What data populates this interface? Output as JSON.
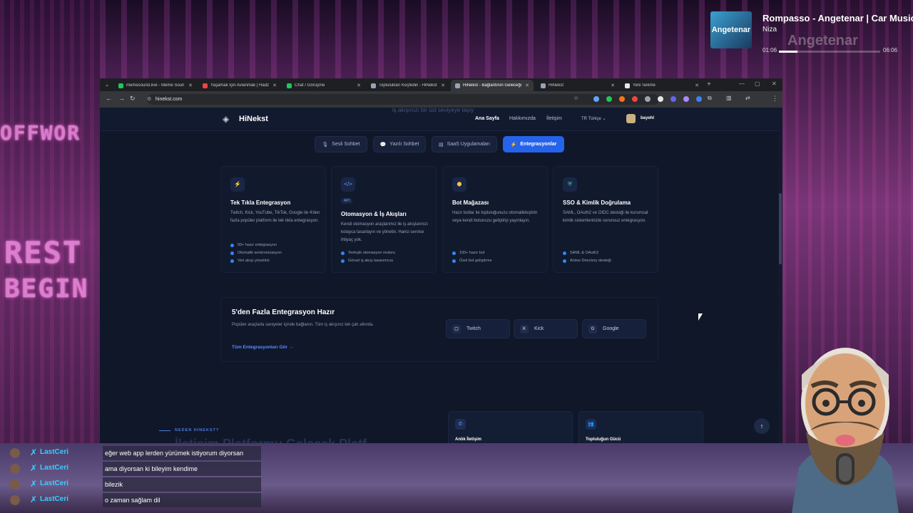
{
  "music": {
    "title": "Rompasso - Angetenar | Car Music",
    "artist": "Niza",
    "cover_text": "Angetenar",
    "ghost_text": "Angetenar",
    "elapsed": "01:06",
    "total": "06:06",
    "progress": 0.18
  },
  "browser": {
    "tabs": [
      {
        "label": "memesound.live - Meme Soun",
        "favicon_color": "#22c55e"
      },
      {
        "label": "Yaşamak İçin Avlanmak | Hadz",
        "favicon_color": "#ef4444"
      },
      {
        "label": "Chat / Görüşme",
        "favicon_color": "#22c55e"
      },
      {
        "label": "Toplulukları Keşfedin - HiNekst",
        "favicon_color": "#94a3b8"
      },
      {
        "label": "HiNekst - Bağlantının Geleceği",
        "favicon_color": "#94a3b8"
      },
      {
        "label": "HiNekst",
        "favicon_color": "#94a3b8"
      },
      {
        "label": "Yeni Sekme",
        "favicon_color": "#e5e7eb"
      }
    ],
    "url": "hinekst.com"
  },
  "site": {
    "logo": "HiNekst",
    "ghost_text": "iş akışınızı bir üst seviyeye taşıy",
    "nav": {
      "home": "Ana Sayfa",
      "about": "Hakkımızda",
      "contact": "İletişim",
      "lang": "TR  Türkçe  ⌄",
      "user": "bayehl"
    },
    "pills": [
      {
        "label": "Sesli Sohbet",
        "icon": "🎙"
      },
      {
        "label": "Yazılı Sohbet",
        "icon": "💬"
      },
      {
        "label": "SaaS Uygulamaları",
        "icon": "▤"
      },
      {
        "label": "Entegrasyonlar",
        "icon": "⚡"
      }
    ],
    "cards": [
      {
        "title": "Tek Tıkla Entegrasyon",
        "icon": "⚡",
        "desc": "Twitch, Kick, YouTube, TikTok, Google ile 4'den fazla popüler platform ile tek tıkla entegrasyon.",
        "features": [
          "50+ hazır entegrasyon",
          "Otomatik senkronizasyon",
          "Veri akışı yönetimi"
        ]
      },
      {
        "title": "Otomasyon & İş Akışları",
        "icon": "</>",
        "badge": "API",
        "desc": "Kendi otomasyon araçlarımız ile iş akışlarınızı kolayca tasarlayın ve yönetin. Harici servise ihtiyaç yok.",
        "features": [
          "Yerleşik otomasyon motoru",
          "Görsel iş akışı tasarımcısı"
        ]
      },
      {
        "title": "Bot Mağazası",
        "icon": "⬢",
        "desc": "Hazır botlar ile topluluğunuzu otomatikleştirin veya kendi botunuzu geliştirip yayınlayın.",
        "features": [
          "100+ hazır bot",
          "Özel bot geliştirme"
        ]
      },
      {
        "title": "SSO & Kimlik Doğrulama",
        "icon": "⛨",
        "desc": "SAML, OAuth2 ve OIDC desteği ile kurumsal kimlik sistemlerinizle sorunsuz entegrasyon.",
        "features": [
          "SAML & OAuth2",
          "Active Directory desteği"
        ]
      }
    ],
    "integrations": {
      "title": "5'den Fazla Entegrasyon Hazır",
      "desc": "Popüler araçlarla saniyeler içinde bağlanın. Tüm iş akışınız tek çatı altında.",
      "link": "Tüm Entegrasyonları Gör →",
      "services": [
        {
          "name": "Twitch",
          "icon": "▢"
        },
        {
          "name": "Kick",
          "icon": "K"
        },
        {
          "name": "Google",
          "icon": "G"
        }
      ]
    },
    "why": {
      "eyebrow": "NEDEN HINEKST?",
      "ghost_title": "İletişim Platformu Gelecek Platf",
      "features": [
        {
          "label": "Anlık İletişim",
          "icon": "✆"
        },
        {
          "label": "Topluluğun Gücü",
          "icon": "👥"
        }
      ]
    }
  },
  "stream": {
    "neon": [
      "OFFWOR",
      "REST",
      "BEGIN"
    ]
  },
  "chat": [
    {
      "user": "LastCeri",
      "message": "eğer web app lerden yürümek istiyorum diyorsan"
    },
    {
      "user": "LastCeri",
      "message": "ama diyorsan ki bileyim kendime"
    },
    {
      "user": "LastCeri",
      "message": "bilezik"
    },
    {
      "user": "LastCeri",
      "message": "o zaman sağlam dil"
    }
  ]
}
